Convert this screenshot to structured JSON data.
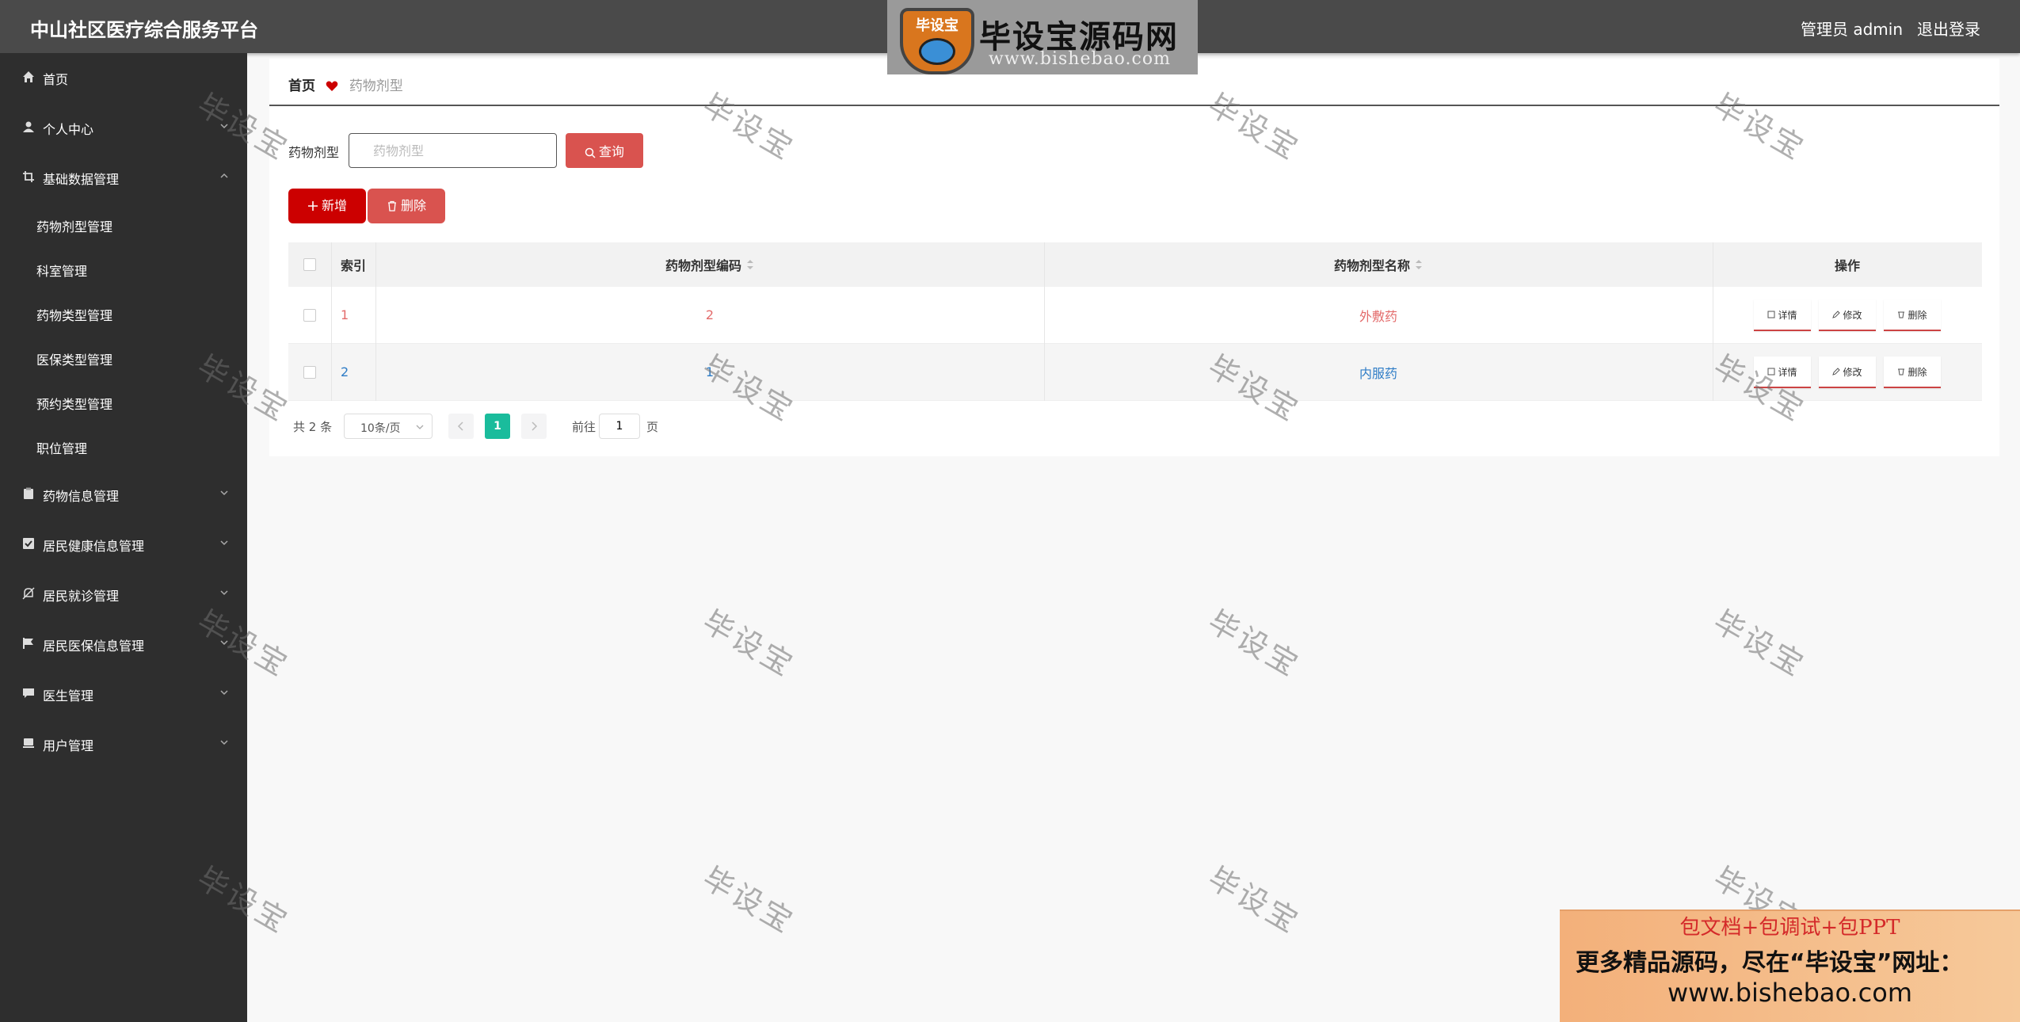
{
  "header": {
    "app_title": "中山社区医疗综合服务平台",
    "user_label": "管理员 admin",
    "logout_label": "退出登录"
  },
  "logo_banner": {
    "emblem_text": "毕设宝",
    "title": "毕设宝源码网",
    "url": "www.bishebao.com"
  },
  "sidebar": {
    "items": [
      {
        "label": "首页",
        "icon": "home-icon"
      },
      {
        "label": "个人中心",
        "icon": "user-icon"
      },
      {
        "label": "基础数据管理",
        "icon": "crop-icon"
      },
      {
        "label": "药物信息管理",
        "icon": "clipboard-icon"
      },
      {
        "label": "居民健康信息管理",
        "icon": "check-square-icon"
      },
      {
        "label": "居民就诊管理",
        "icon": "bell-off-icon"
      },
      {
        "label": "居民医保信息管理",
        "icon": "flag-icon"
      },
      {
        "label": "医生管理",
        "icon": "chat-icon"
      },
      {
        "label": "用户管理",
        "icon": "printer-icon"
      }
    ],
    "sub_items": [
      "药物剂型管理",
      "科室管理",
      "药物类型管理",
      "医保类型管理",
      "预约类型管理",
      "职位管理"
    ]
  },
  "breadcrumb": {
    "home": "首页",
    "current": "药物剂型"
  },
  "search": {
    "label": "药物剂型",
    "placeholder": "药物剂型",
    "button": "查询"
  },
  "actions": {
    "add": "新增",
    "delete": "删除"
  },
  "table": {
    "columns": [
      "索引",
      "药物剂型编码",
      "药物剂型名称",
      "操作"
    ],
    "rows": [
      {
        "index": "1",
        "code": "2",
        "name": "外敷药"
      },
      {
        "index": "2",
        "code": "1",
        "name": "内服药"
      }
    ],
    "row_actions": [
      "详情",
      "修改",
      "删除"
    ]
  },
  "pagination": {
    "total": "共 2 条",
    "page_size": "10条/页",
    "current_page": "1",
    "goto_label": "前往",
    "goto_value": "1",
    "goto_unit": "页"
  },
  "watermark": "毕设宝",
  "promo": {
    "line1": "包文档+包调试+包PPT",
    "line2": "更多精品源码，尽在“毕设宝”网址：",
    "line3": "www.bishebao.com"
  },
  "colors": {
    "header_bg": "#4a4a4a",
    "sidebar_bg": "#2e2e2e",
    "primary_red": "#cc0000",
    "soft_red": "#d9534f",
    "page_active": "#1abc9c"
  }
}
